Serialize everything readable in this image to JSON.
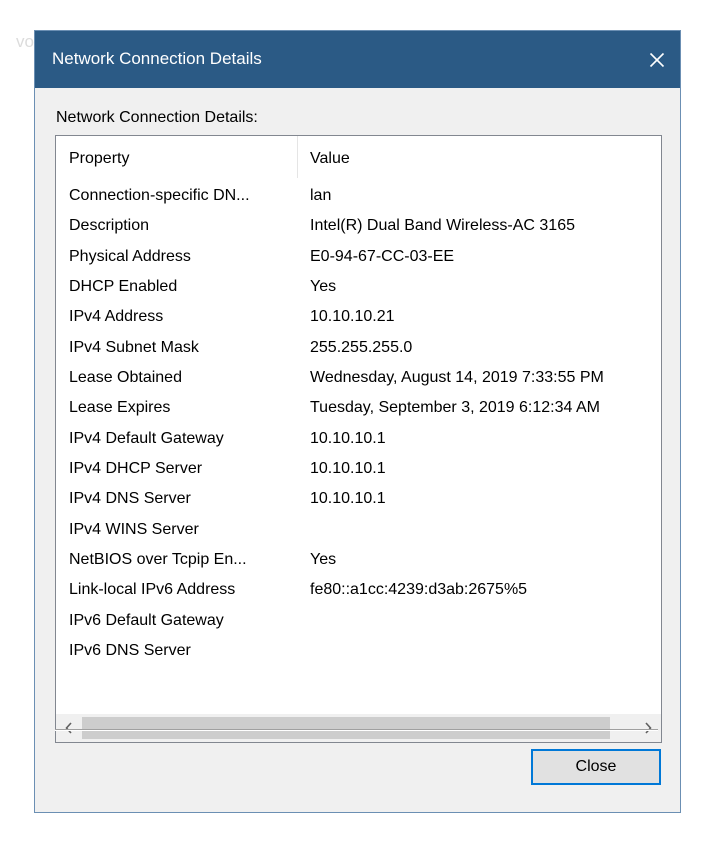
{
  "background_fragment": "vo",
  "window": {
    "title": "Network Connection Details",
    "close_icon": "close-icon",
    "titlebar_color": "#2b5a85"
  },
  "section_label": "Network Connection Details:",
  "list": {
    "columns": [
      "Property",
      "Value"
    ],
    "rows": [
      {
        "property": "Connection-specific DN...",
        "value": "lan"
      },
      {
        "property": "Description",
        "value": "Intel(R) Dual Band Wireless-AC 3165"
      },
      {
        "property": "Physical Address",
        "value": "E0-94-67-CC-03-EE"
      },
      {
        "property": "DHCP Enabled",
        "value": "Yes"
      },
      {
        "property": "IPv4 Address",
        "value": "10.10.10.21"
      },
      {
        "property": "IPv4 Subnet Mask",
        "value": "255.255.255.0"
      },
      {
        "property": "Lease Obtained",
        "value": "Wednesday, August 14, 2019 7:33:55 PM"
      },
      {
        "property": "Lease Expires",
        "value": "Tuesday, September 3, 2019 6:12:34 AM"
      },
      {
        "property": "IPv4 Default Gateway",
        "value": "10.10.10.1"
      },
      {
        "property": "IPv4 DHCP Server",
        "value": "10.10.10.1"
      },
      {
        "property": "IPv4 DNS Server",
        "value": "10.10.10.1"
      },
      {
        "property": "IPv4 WINS Server",
        "value": ""
      },
      {
        "property": "NetBIOS over Tcpip En...",
        "value": "Yes"
      },
      {
        "property": "Link-local IPv6 Address",
        "value": "fe80::a1cc:4239:d3ab:2675%5"
      },
      {
        "property": "IPv6 Default Gateway",
        "value": ""
      },
      {
        "property": "IPv6 DNS Server",
        "value": ""
      }
    ]
  },
  "scrollbar": {
    "left_arrow_icon": "chevron-left-icon",
    "right_arrow_icon": "chevron-right-icon"
  },
  "buttons": {
    "close_label": "Close"
  }
}
